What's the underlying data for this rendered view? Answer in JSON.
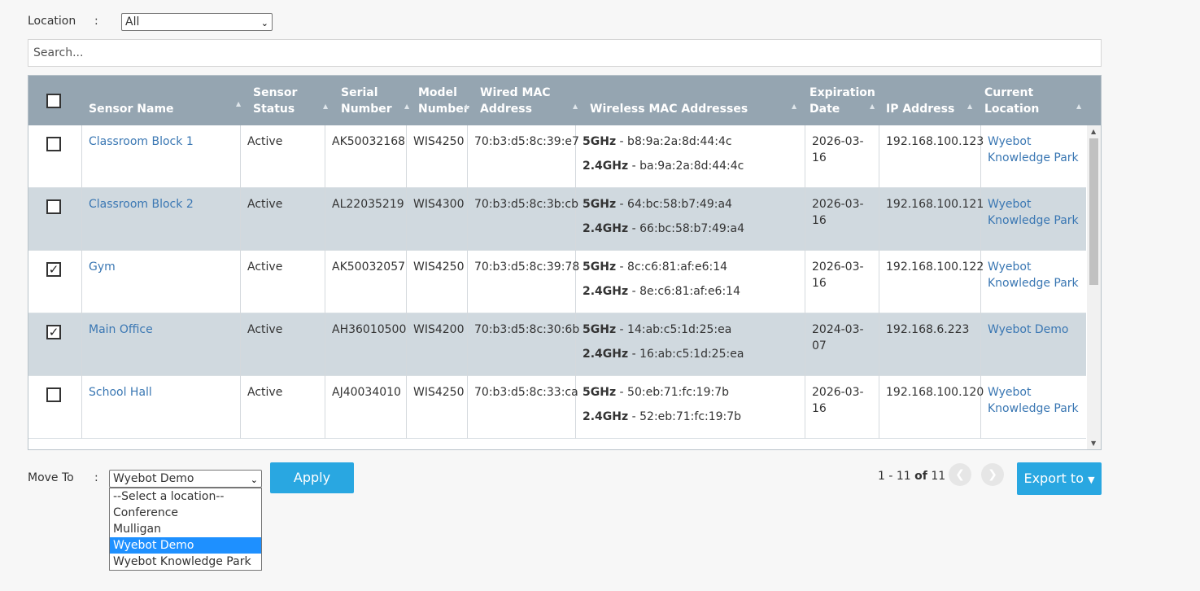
{
  "filter": {
    "location_label": "Location",
    "colon": ":",
    "location_value": "All",
    "search_placeholder": "Search..."
  },
  "table": {
    "columns": [
      {
        "key": "name",
        "label": "Sensor Name"
      },
      {
        "key": "status",
        "label": "Sensor Status"
      },
      {
        "key": "serial",
        "label": "Serial Number"
      },
      {
        "key": "model",
        "label": "Model Number"
      },
      {
        "key": "wired",
        "label": "Wired MAC Address"
      },
      {
        "key": "wireless",
        "label": "Wireless MAC Addresses"
      },
      {
        "key": "expiry",
        "label": "Expiration Date"
      },
      {
        "key": "ip",
        "label": "IP Address"
      },
      {
        "key": "location",
        "label": "Current Location"
      }
    ],
    "rows": [
      {
        "checked": false,
        "name": "Classroom Block 1",
        "status": "Active",
        "serial": "AK50032168",
        "model": "WIS4250",
        "wired": "70:b3:d5:8c:39:e7",
        "mac5_label": "5GHz",
        "mac5": " - b8:9a:2a:8d:44:4c",
        "mac24_label": "2.4GHz",
        "mac24": " - ba:9a:2a:8d:44:4c",
        "expiry": "2026-03-16",
        "ip": "192.168.100.123",
        "location": "Wyebot Knowledge Park"
      },
      {
        "checked": false,
        "name": "Classroom Block 2",
        "status": "Active",
        "serial": "AL22035219",
        "model": "WIS4300",
        "wired": "70:b3:d5:8c:3b:cb",
        "mac5_label": "5GHz",
        "mac5": " - 64:bc:58:b7:49:a4",
        "mac24_label": "2.4GHz",
        "mac24": " - 66:bc:58:b7:49:a4",
        "expiry": "2026-03-16",
        "ip": "192.168.100.121",
        "location": "Wyebot Knowledge Park"
      },
      {
        "checked": true,
        "name": "Gym",
        "status": "Active",
        "serial": "AK50032057",
        "model": "WIS4250",
        "wired": "70:b3:d5:8c:39:78",
        "mac5_label": "5GHz",
        "mac5": " - 8c:c6:81:af:e6:14",
        "mac24_label": "2.4GHz",
        "mac24": " - 8e:c6:81:af:e6:14",
        "expiry": "2026-03-16",
        "ip": "192.168.100.122",
        "location": "Wyebot Knowledge Park"
      },
      {
        "checked": true,
        "name": "Main Office",
        "status": "Active",
        "serial": "AH36010500",
        "model": "WIS4200",
        "wired": "70:b3:d5:8c:30:6b",
        "mac5_label": "5GHz",
        "mac5": " - 14:ab:c5:1d:25:ea",
        "mac24_label": "2.4GHz",
        "mac24": " - 16:ab:c5:1d:25:ea",
        "expiry": "2024-03-07",
        "ip": "192.168.6.223",
        "location": "Wyebot Demo"
      },
      {
        "checked": false,
        "name": "School Hall",
        "status": "Active",
        "serial": "AJ40034010",
        "model": "WIS4250",
        "wired": "70:b3:d5:8c:33:ca",
        "mac5_label": "5GHz",
        "mac5": " - 50:eb:71:fc:19:7b",
        "mac24_label": "2.4GHz",
        "mac24": " - 52:eb:71:fc:19:7b",
        "expiry": "2026-03-16",
        "ip": "192.168.100.120",
        "location": "Wyebot Knowledge Park"
      }
    ]
  },
  "move": {
    "label": "Move To",
    "colon": ":",
    "selected": "Wyebot Demo",
    "options": [
      "--Select a location--",
      "Conference",
      "Mulligan",
      "Wyebot Demo",
      "Wyebot Knowledge Park"
    ],
    "apply_label": "Apply"
  },
  "pager": {
    "range": "1 - 11",
    "of_label": "of",
    "total": "11"
  },
  "export_label": "Export to",
  "colors": {
    "accent": "#29a7e1",
    "header_bg": "#95a5b1",
    "link": "#3a77b3",
    "alt_row": "#d0d9df"
  }
}
